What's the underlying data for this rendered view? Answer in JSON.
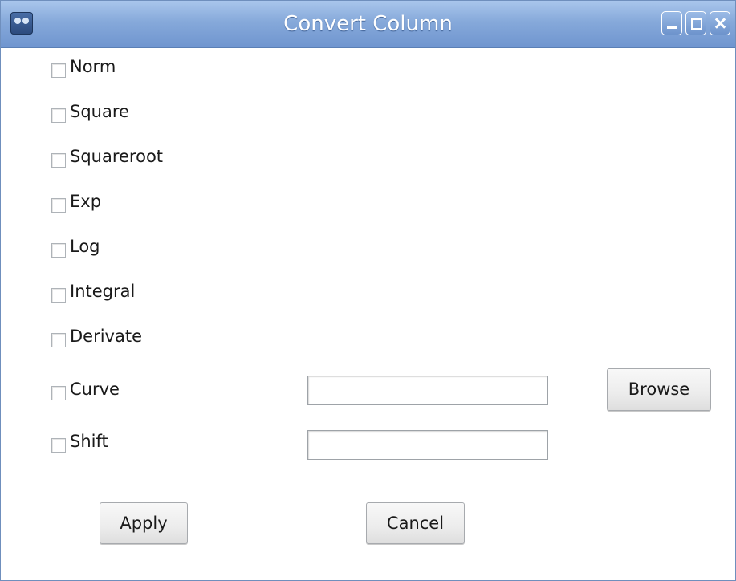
{
  "window": {
    "title": "Convert Column",
    "app_icon": "gnome-foot-icon",
    "controls": [
      "minimize-icon",
      "maximize-icon",
      "close-icon"
    ]
  },
  "options": [
    {
      "label": "Norm",
      "checked": false
    },
    {
      "label": "Square",
      "checked": false
    },
    {
      "label": "Squareroot",
      "checked": false
    },
    {
      "label": "Exp",
      "checked": false
    },
    {
      "label": "Log",
      "checked": false
    },
    {
      "label": "Integral",
      "checked": false
    },
    {
      "label": "Derivate",
      "checked": false
    },
    {
      "label": "Curve",
      "checked": false
    },
    {
      "label": "Shift",
      "checked": false
    }
  ],
  "curve_input": {
    "value": "",
    "placeholder": ""
  },
  "shift_input": {
    "value": "",
    "placeholder": ""
  },
  "buttons": {
    "browse": "Browse",
    "apply": "Apply",
    "cancel": "Cancel"
  },
  "colors": {
    "titlebar": "#86a9da",
    "title_text": "#ffffff",
    "background": "#ffffff"
  }
}
